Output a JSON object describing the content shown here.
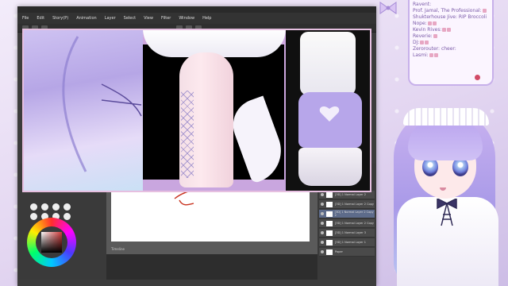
{
  "app": {
    "menu": [
      "File",
      "Edit",
      "Story(P)",
      "Animation",
      "Layer",
      "Select",
      "View",
      "Filter",
      "Window",
      "Help"
    ],
    "layers": [
      "[3D] 1 Normal Layer 2",
      "[3D] 1 Normal Layer 2 Copy",
      "[3D] 1 Normal Layer 2 Copy 2",
      "[3D] 1 Normal Layer 2 Copy",
      "[3D] 1 Normal Layer 3",
      "[3D] 1 Normal Layer 1",
      "Paper"
    ],
    "timeline_label": "Timeline",
    "accent_color": "#d23a3a"
  },
  "chat": {
    "messages": [
      "Ravent:",
      "Prof. Jamal, The Professional:",
      "Shukterhouse Jive: RIP Broccoli",
      "Nope:",
      "Kevin Rives:",
      "Reverie:",
      "DJ:",
      "Zerorouter: cheer:",
      "Lasmi:"
    ]
  },
  "icons": {
    "heart": "heart-icon",
    "bow": "bow-icon",
    "record": "record-dot-icon"
  },
  "colors": {
    "frame": "#c7b0ea",
    "text": "#7a5aa8",
    "shoe": "#b7a6ea"
  }
}
